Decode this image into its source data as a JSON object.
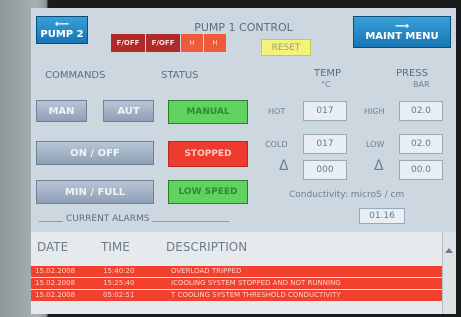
{
  "header": {
    "title": "PUMP 1 CONTROL",
    "pump_button": "PUMP 2",
    "maint_button": "MAINT MENU",
    "reset_button": "RESET",
    "flags": [
      "F/OFF",
      "F/OFF",
      "H",
      "H"
    ]
  },
  "labels": {
    "commands": "COMMANDS",
    "status": "STATUS",
    "temp": "TEMP",
    "temp_unit": "°C",
    "press": "PRESS",
    "press_unit": "BAR",
    "hot": "HOT",
    "cold": "COLD",
    "high": "HIGH",
    "low": "LOW",
    "delta": "Δ",
    "conductivity": "Conductivity: microS / cm"
  },
  "commands": {
    "man": "MAN",
    "aut": "AUT",
    "on_off": "ON / OFF",
    "min_full": "MIN / FULL"
  },
  "status": {
    "mode": "MANUAL",
    "state": "STOPPED",
    "speed": "LOW SPEED"
  },
  "readings": {
    "temp_hot": "017",
    "temp_cold": "017",
    "temp_delta": "000",
    "press_high": "02.0",
    "press_low": "02.0",
    "press_delta": "00.0",
    "conductivity": "01.16"
  },
  "alarms": {
    "section_title": "CURRENT ALARMS",
    "columns": [
      "DATE",
      "TIME",
      "DESCRIPTION"
    ],
    "rows": [
      {
        "date": "15.02.2008",
        "time": "15:40:20",
        "desc": "OVERLOAD TRIPPED"
      },
      {
        "date": "15.02.2008",
        "time": "15:25:40",
        "desc": "ICOOLING SYSTEM STOPPED AND NOT RUNNING"
      },
      {
        "date": "15.02.2008",
        "time": "05:02:51",
        "desc": "T COOLING SYSTEM THRESHOLD CONDUCTIVITY"
      }
    ]
  },
  "colors": {
    "accent_blue": "#1f86c6",
    "alarm_red": "#f2402f",
    "status_green": "#5fd25f",
    "status_red": "#ee3a2f"
  }
}
